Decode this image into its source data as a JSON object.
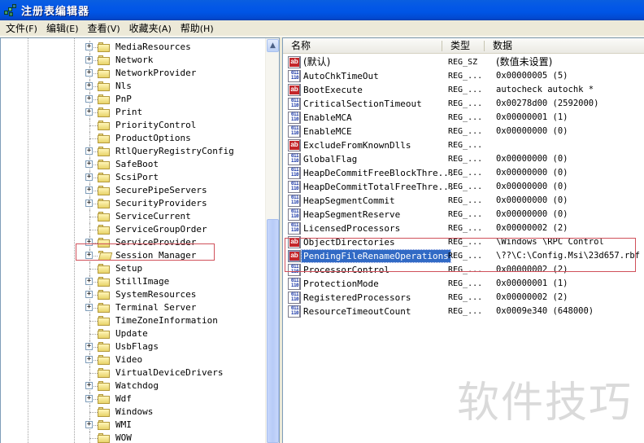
{
  "window": {
    "title": "注册表编辑器",
    "icon": "registry-editor-icon"
  },
  "menu": [
    {
      "label": "文件",
      "accel": "(F)"
    },
    {
      "label": "编辑",
      "accel": "(E)"
    },
    {
      "label": "查看",
      "accel": "(V)"
    },
    {
      "label": "收藏夹",
      "accel": "(A)"
    },
    {
      "label": "帮助",
      "accel": "(H)"
    }
  ],
  "tree": {
    "items": [
      {
        "label": "MediaResources",
        "expandable": true
      },
      {
        "label": "Network",
        "expandable": true
      },
      {
        "label": "NetworkProvider",
        "expandable": true
      },
      {
        "label": "Nls",
        "expandable": true
      },
      {
        "label": "PnP",
        "expandable": true
      },
      {
        "label": "Print",
        "expandable": true
      },
      {
        "label": "PriorityControl",
        "expandable": false
      },
      {
        "label": "ProductOptions",
        "expandable": false
      },
      {
        "label": "RtlQueryRegistryConfig",
        "expandable": true
      },
      {
        "label": "SafeBoot",
        "expandable": true
      },
      {
        "label": "ScsiPort",
        "expandable": true
      },
      {
        "label": "SecurePipeServers",
        "expandable": true
      },
      {
        "label": "SecurityProviders",
        "expandable": true
      },
      {
        "label": "ServiceCurrent",
        "expandable": false
      },
      {
        "label": "ServiceGroupOrder",
        "expandable": false
      },
      {
        "label": "ServiceProvider",
        "expandable": true
      },
      {
        "label": "Session Manager",
        "expandable": true,
        "selected": true,
        "open": true
      },
      {
        "label": "Setup",
        "expandable": false
      },
      {
        "label": "StillImage",
        "expandable": true
      },
      {
        "label": "SystemResources",
        "expandable": true
      },
      {
        "label": "Terminal Server",
        "expandable": true
      },
      {
        "label": "TimeZoneInformation",
        "expandable": false
      },
      {
        "label": "Update",
        "expandable": false
      },
      {
        "label": "UsbFlags",
        "expandable": true
      },
      {
        "label": "Video",
        "expandable": true
      },
      {
        "label": "VirtualDeviceDrivers",
        "expandable": false
      },
      {
        "label": "Watchdog",
        "expandable": true
      },
      {
        "label": "Wdf",
        "expandable": true
      },
      {
        "label": "Windows",
        "expandable": false
      },
      {
        "label": "WMI",
        "expandable": true
      },
      {
        "label": "WOW",
        "expandable": false
      }
    ],
    "expander_symbol": "+"
  },
  "list": {
    "columns": {
      "name": "名称",
      "type": "类型",
      "data": "数据"
    },
    "rows": [
      {
        "icon": "string-value-icon",
        "kind": "sz",
        "name": "(默认)",
        "type": "REG_SZ",
        "data": "(数值未设置)"
      },
      {
        "icon": "binary-value-icon",
        "kind": "bin",
        "name": "AutoChkTimeOut",
        "type": "REG_...",
        "data": "0x00000005 (5)"
      },
      {
        "icon": "string-value-icon",
        "kind": "sz",
        "name": "BootExecute",
        "type": "REG_...",
        "data": "autocheck autochk *"
      },
      {
        "icon": "binary-value-icon",
        "kind": "bin",
        "name": "CriticalSectionTimeout",
        "type": "REG_...",
        "data": "0x00278d00 (2592000)"
      },
      {
        "icon": "binary-value-icon",
        "kind": "bin",
        "name": "EnableMCA",
        "type": "REG_...",
        "data": "0x00000001 (1)"
      },
      {
        "icon": "binary-value-icon",
        "kind": "bin",
        "name": "EnableMCE",
        "type": "REG_...",
        "data": "0x00000000 (0)"
      },
      {
        "icon": "string-value-icon",
        "kind": "sz",
        "name": "ExcludeFromKnownDlls",
        "type": "REG_...",
        "data": ""
      },
      {
        "icon": "binary-value-icon",
        "kind": "bin",
        "name": "GlobalFlag",
        "type": "REG_...",
        "data": "0x00000000 (0)"
      },
      {
        "icon": "binary-value-icon",
        "kind": "bin",
        "name": "HeapDeCommitFreeBlockThre...",
        "type": "REG_...",
        "data": "0x00000000 (0)"
      },
      {
        "icon": "binary-value-icon",
        "kind": "bin",
        "name": "HeapDeCommitTotalFreeThre...",
        "type": "REG_...",
        "data": "0x00000000 (0)"
      },
      {
        "icon": "binary-value-icon",
        "kind": "bin",
        "name": "HeapSegmentCommit",
        "type": "REG_...",
        "data": "0x00000000 (0)"
      },
      {
        "icon": "binary-value-icon",
        "kind": "bin",
        "name": "HeapSegmentReserve",
        "type": "REG_...",
        "data": "0x00000000 (0)"
      },
      {
        "icon": "binary-value-icon",
        "kind": "bin",
        "name": "LicensedProcessors",
        "type": "REG_...",
        "data": "0x00000002 (2)"
      },
      {
        "icon": "string-value-icon",
        "kind": "sz",
        "name": "ObjectDirectories",
        "type": "REG_...",
        "data": "\\Windows \\RPC Control"
      },
      {
        "icon": "string-value-icon",
        "kind": "sz",
        "name": "PendingFileRenameOperations",
        "type": "REG_...",
        "data": "\\??\\C:\\Config.Msi\\23d657.rbf",
        "selected": true
      },
      {
        "icon": "binary-value-icon",
        "kind": "bin",
        "name": "ProcessorControl",
        "type": "REG_...",
        "data": "0x00000002 (2)"
      },
      {
        "icon": "binary-value-icon",
        "kind": "bin",
        "name": "ProtectionMode",
        "type": "REG_...",
        "data": "0x00000001 (1)"
      },
      {
        "icon": "binary-value-icon",
        "kind": "bin",
        "name": "RegisteredProcessors",
        "type": "REG_...",
        "data": "0x00000002 (2)"
      },
      {
        "icon": "binary-value-icon",
        "kind": "bin",
        "name": "ResourceTimeoutCount",
        "type": "REG_...",
        "data": "0x0009e340 (648000)"
      }
    ]
  },
  "icon_glyphs": {
    "sz": "ab",
    "bin": "011 110"
  },
  "scrollbar": {
    "up_arrow": "▲"
  },
  "watermark": "软件技巧",
  "colors": {
    "titlebar": "#0055e5",
    "selection": "#316ac5",
    "annotation_box": "#d0505a"
  }
}
